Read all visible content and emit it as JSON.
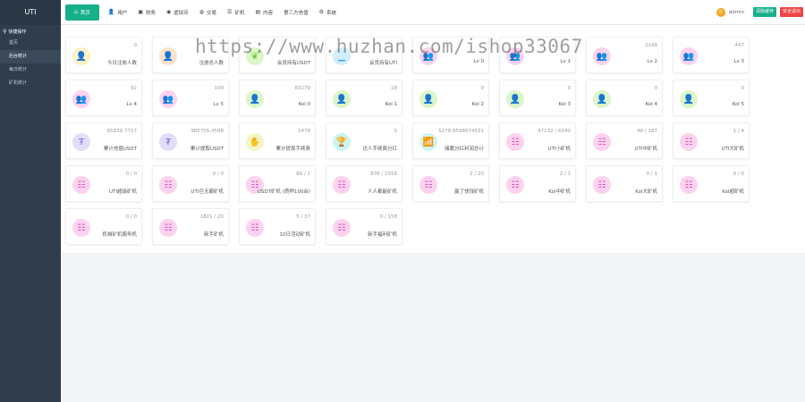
{
  "sidebar": {
    "brand": "UTI",
    "section": "快捷操作",
    "items": [
      {
        "label": "首页"
      },
      {
        "label": "后台统计"
      },
      {
        "label": "每日统计"
      },
      {
        "label": "矿机统计"
      }
    ]
  },
  "topbar": {
    "tabs": [
      {
        "label": "首页",
        "icon": "home-icon",
        "glyph": "⌂"
      },
      {
        "label": "用户",
        "icon": "user-icon",
        "glyph": "👤"
      },
      {
        "label": "财务",
        "icon": "wallet-icon",
        "glyph": "▣"
      },
      {
        "label": "虚拟币",
        "icon": "coin-icon",
        "glyph": "◉"
      },
      {
        "label": "交易",
        "icon": "globe-icon",
        "glyph": "◍"
      },
      {
        "label": "矿机",
        "icon": "list-icon",
        "glyph": "☰"
      },
      {
        "label": "内容",
        "icon": "content-icon",
        "glyph": "▤"
      },
      {
        "label": "第三方充值",
        "icon": "",
        "glyph": ""
      },
      {
        "label": "系统",
        "icon": "gear-icon",
        "glyph": "⚙"
      }
    ],
    "badge": "0",
    "user": "admin",
    "clear_cache": "清除缓存",
    "logout": "安全退出"
  },
  "watermark": "https://www.huzhan.com/ishop33067",
  "cards": [
    {
      "value": "0",
      "label": "今日注册人数",
      "color": "yellow",
      "icon": "user-icon",
      "glyph": "👤"
    },
    {
      "value": "",
      "label": "注册总人数",
      "color": "orange",
      "icon": "user-icon",
      "glyph": "👤"
    },
    {
      "value": "",
      "label": "会员持有USDT",
      "color": "green",
      "icon": "leaf-icon",
      "glyph": "❦"
    },
    {
      "value": "",
      "label": "会员持有UTI",
      "color": "blue",
      "icon": "chart-icon",
      "glyph": "▁"
    },
    {
      "value": "",
      "label": "Lv 0",
      "color": "pink",
      "icon": "group-icon",
      "glyph": "👥"
    },
    {
      "value": "",
      "label": "Lv 1",
      "color": "pink",
      "icon": "group-icon",
      "glyph": "👥"
    },
    {
      "value": "2149",
      "label": "Lv 2",
      "color": "pink",
      "icon": "group-icon",
      "glyph": "👥"
    },
    {
      "value": "447",
      "label": "Lv 3",
      "color": "pink",
      "icon": "group-icon",
      "glyph": "👥"
    },
    {
      "value": "92",
      "label": "Lv 4",
      "color": "pink",
      "icon": "group-icon",
      "glyph": "👥"
    },
    {
      "value": "109",
      "label": "Lv 5",
      "color": "pink",
      "icon": "group-icon",
      "glyph": "👥"
    },
    {
      "value": "83279",
      "label": "Kol 0",
      "color": "green",
      "icon": "user-icon",
      "glyph": "👤"
    },
    {
      "value": "18",
      "label": "Kol 1",
      "color": "green",
      "icon": "user-icon",
      "glyph": "👤"
    },
    {
      "value": "0",
      "label": "Kol 2",
      "color": "green",
      "icon": "user-icon",
      "glyph": "👤"
    },
    {
      "value": "0",
      "label": "Kol 3",
      "color": "green",
      "icon": "user-icon",
      "glyph": "👤"
    },
    {
      "value": "0",
      "label": "Kol 4",
      "color": "green",
      "icon": "user-icon",
      "glyph": "👤"
    },
    {
      "value": "0",
      "label": "Kol 5",
      "color": "green",
      "icon": "user-icon",
      "glyph": "👤"
    },
    {
      "value": "85830.7717",
      "label": "累计充值USDT",
      "color": "purple",
      "icon": "currency-icon",
      "glyph": "Ŧ"
    },
    {
      "value": "985705.4598",
      "label": "累计提取USDT",
      "color": "purple",
      "icon": "currency-icon",
      "glyph": "₮"
    },
    {
      "value": "1478",
      "label": "累计提现手续费",
      "color": "lemon",
      "icon": "hand-coin-icon",
      "glyph": "✋"
    },
    {
      "value": "0",
      "label": "达人手续费分红",
      "color": "cyan",
      "icon": "trophy-icon",
      "glyph": "🏆"
    },
    {
      "value": "5278.8598074531",
      "label": "储蓄分红利润总计",
      "color": "cyan",
      "icon": "wifi-icon",
      "glyph": "📶"
    },
    {
      "value": "47132 / 6540",
      "label": "UTI小矿机",
      "color": "pink",
      "icon": "miner-icon",
      "glyph": "☷"
    },
    {
      "value": "48 / 187",
      "label": "UTI中矿机",
      "color": "pink",
      "icon": "miner-icon",
      "glyph": "☷"
    },
    {
      "value": "1 / 4",
      "label": "UTI大矿机",
      "color": "pink",
      "icon": "miner-icon",
      "glyph": "☷"
    },
    {
      "value": "0 / 0",
      "label": "UTI超级矿机",
      "color": "pink",
      "icon": "miner-icon",
      "glyph": "☷"
    },
    {
      "value": "0 / 0",
      "label": "UTI巨无霸矿机",
      "color": "pink",
      "icon": "miner-icon",
      "glyph": "☷"
    },
    {
      "value": "89 / 1",
      "label": "USDT矿机 (质押100台)",
      "color": "pink",
      "icon": "miner-icon",
      "glyph": "☷"
    },
    {
      "value": "838 / 1018",
      "label": "人人都能矿机",
      "color": "pink",
      "icon": "miner-icon",
      "glyph": "☷"
    },
    {
      "value": "2 / 20",
      "label": "赢了快钱矿机",
      "color": "pink",
      "icon": "miner-icon",
      "glyph": "☷"
    },
    {
      "value": "2 / 1",
      "label": "Kol中矿机",
      "color": "pink",
      "icon": "miner-icon",
      "glyph": "☷"
    },
    {
      "value": "0 / 1",
      "label": "Kol大矿机",
      "color": "pink",
      "icon": "miner-icon",
      "glyph": "☷"
    },
    {
      "value": "0 / 0",
      "label": "Kol超矿机",
      "color": "pink",
      "icon": "miner-icon",
      "glyph": "☷"
    },
    {
      "value": "0 / 0",
      "label": "机械矿机服务机",
      "color": "pink",
      "icon": "miner-icon",
      "glyph": "☷"
    },
    {
      "value": "1801 / 20",
      "label": "新手矿机",
      "color": "pink",
      "icon": "miner-icon",
      "glyph": "☷"
    },
    {
      "value": "5 / 37",
      "label": "10日活动矿机",
      "color": "pink",
      "icon": "miner-icon",
      "glyph": "☷"
    },
    {
      "value": "0 / 158",
      "label": "新手福利矿机",
      "color": "pink",
      "icon": "miner-icon",
      "glyph": "☷"
    }
  ]
}
